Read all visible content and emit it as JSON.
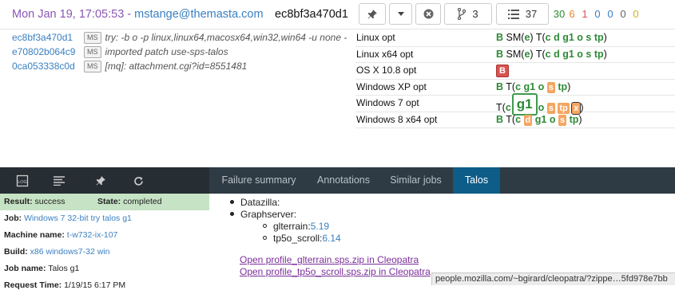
{
  "resultset": {
    "date": "Mon Jan 19, 17:05:53",
    "separator": " - ",
    "author": "mstange@themasta.com",
    "revision": "ec8bf3a470d1",
    "buttons": {
      "pin_icon": "pin-icon",
      "dropdown_icon": "chevron-down-icon",
      "cancel_icon": "cancel-icon",
      "branch_icon": "branch-icon",
      "branch_count": "3",
      "list_icon": "list-icon",
      "list_count": "37"
    },
    "counts": [
      {
        "value": "30",
        "color": "#2d8a35"
      },
      {
        "value": "6",
        "color": "#e8832b"
      },
      {
        "value": "1",
        "color": "#d9534f"
      },
      {
        "value": "0",
        "color": "#3a7fc1"
      },
      {
        "value": "0",
        "color": "#3a7fc1"
      },
      {
        "value": "0",
        "color": "#666666"
      },
      {
        "value": "0",
        "color": "#c9b22f"
      }
    ]
  },
  "revisions": [
    {
      "id": "ec8bf3a470d1",
      "badge": "MS",
      "message": "try: -b o -p linux,linux64,macosx64,win32,win64 -u none -"
    },
    {
      "id": "e70802b064c9",
      "badge": "MS",
      "message": "imported patch use-sps-talos"
    },
    {
      "id": "0ca053338c0d",
      "badge": "MS",
      "message": "[mq]: attachment.cgi?id=8551481"
    }
  ],
  "platforms": [
    {
      "name": "Linux opt"
    },
    {
      "name": "Linux x64 opt"
    },
    {
      "name": "OS X 10.8 opt"
    },
    {
      "name": "Windows XP opt"
    },
    {
      "name": "Windows 7 opt"
    },
    {
      "name": "Windows 8 x64 opt"
    }
  ],
  "jobs": {
    "B": "B",
    "SM": "SM(",
    "T": "T(",
    "close": ")",
    "e": "e",
    "c": "c",
    "d": "d",
    "g1": "g1",
    "o": "o",
    "s": "s",
    "tp": "tp",
    "x": "x"
  },
  "nav": {
    "icons": [
      "log-icon",
      "lines-icon",
      "pin-icon",
      "refresh-icon"
    ],
    "tabs": [
      {
        "label": "Failure summary",
        "active": false
      },
      {
        "label": "Annotations",
        "active": false
      },
      {
        "label": "Similar jobs",
        "active": false
      },
      {
        "label": "Talos",
        "active": true
      }
    ]
  },
  "summary": {
    "result_label": "Result:",
    "result_value": "success",
    "state_label": "State:",
    "state_value": "completed",
    "rows": [
      {
        "label": "Job:",
        "value": "Windows 7 32-bit try talos g1",
        "link": true
      },
      {
        "label": "Machine name:",
        "value": "t-w732-ix-107",
        "link": true
      },
      {
        "label": "Build:",
        "value": "x86 windows7-32 win",
        "link": true
      },
      {
        "label": "Job name:",
        "value": "Talos g1",
        "link": false
      },
      {
        "label": "Request Time:",
        "value": "1/19/15 6:17 PM",
        "link": false
      }
    ]
  },
  "talos": {
    "datazilla": "Datazilla:",
    "graphserver": "Graphserver:",
    "items": [
      {
        "name": "glterrain:",
        "value": "5.19"
      },
      {
        "name": "tp5o_scroll:",
        "value": "6.14"
      }
    ],
    "links": [
      "Open profile_glterrain.sps.zip in Cleopatra",
      "Open profile_tp5o_scroll.sps.zip in Cleopatra"
    ]
  },
  "statusbar": "people.mozilla.com/~bgirard/cleopatra/?zippe…5fd978e7bb"
}
